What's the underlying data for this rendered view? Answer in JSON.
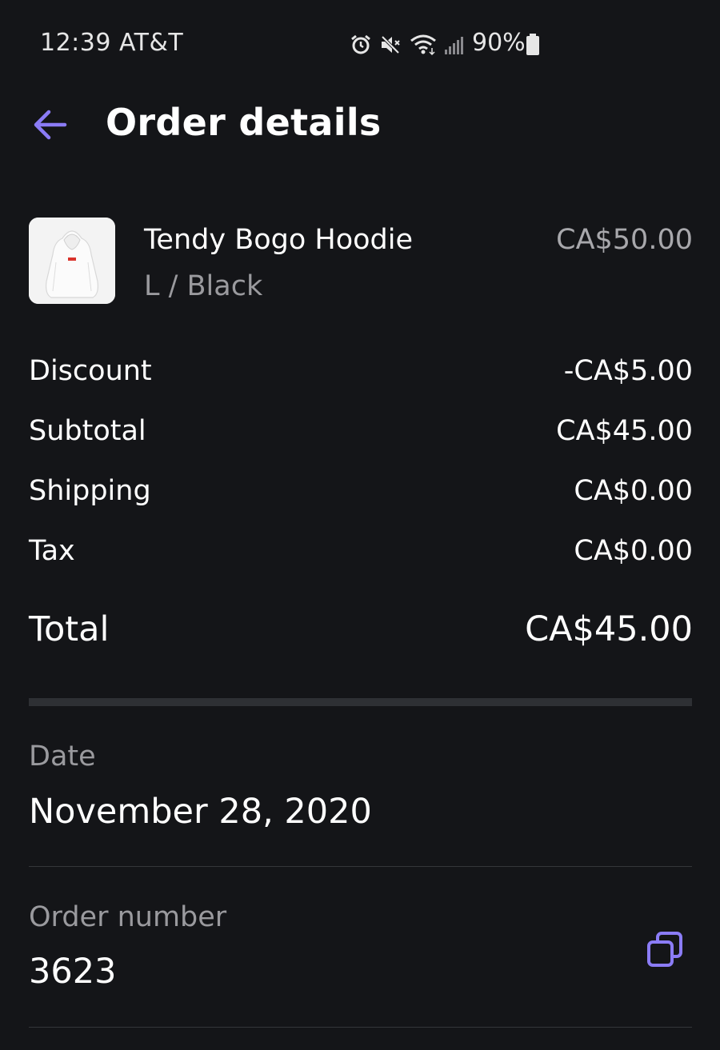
{
  "status_bar": {
    "time_carrier": "12:39 AT&T",
    "battery": "90%",
    "icons": [
      "alarm-icon",
      "mute-icon",
      "wifi-icon",
      "signal-icon",
      "battery-icon"
    ]
  },
  "header": {
    "title": "Order details",
    "back_icon": "arrow-left-icon",
    "accent_color": "#8b7cf6"
  },
  "product": {
    "name": "Tendy Bogo Hoodie",
    "variant": "L / Black",
    "price": "CA$50.00",
    "thumbnail": "hoodie-image"
  },
  "summary": {
    "discount": {
      "label": "Discount",
      "value": "-CA$5.00"
    },
    "subtotal": {
      "label": "Subtotal",
      "value": "CA$45.00"
    },
    "shipping": {
      "label": "Shipping",
      "value": "CA$0.00"
    },
    "tax": {
      "label": "Tax",
      "value": "CA$0.00"
    },
    "total": {
      "label": "Total",
      "value": "CA$45.00"
    }
  },
  "details": {
    "date": {
      "label": "Date",
      "value": "November 28, 2020"
    },
    "order_number": {
      "label": "Order number",
      "value": "3623",
      "copy_icon": "copy-icon"
    }
  },
  "colors": {
    "background": "#141518",
    "muted_text": "#9a9a9e",
    "accent": "#8b7cf6"
  }
}
